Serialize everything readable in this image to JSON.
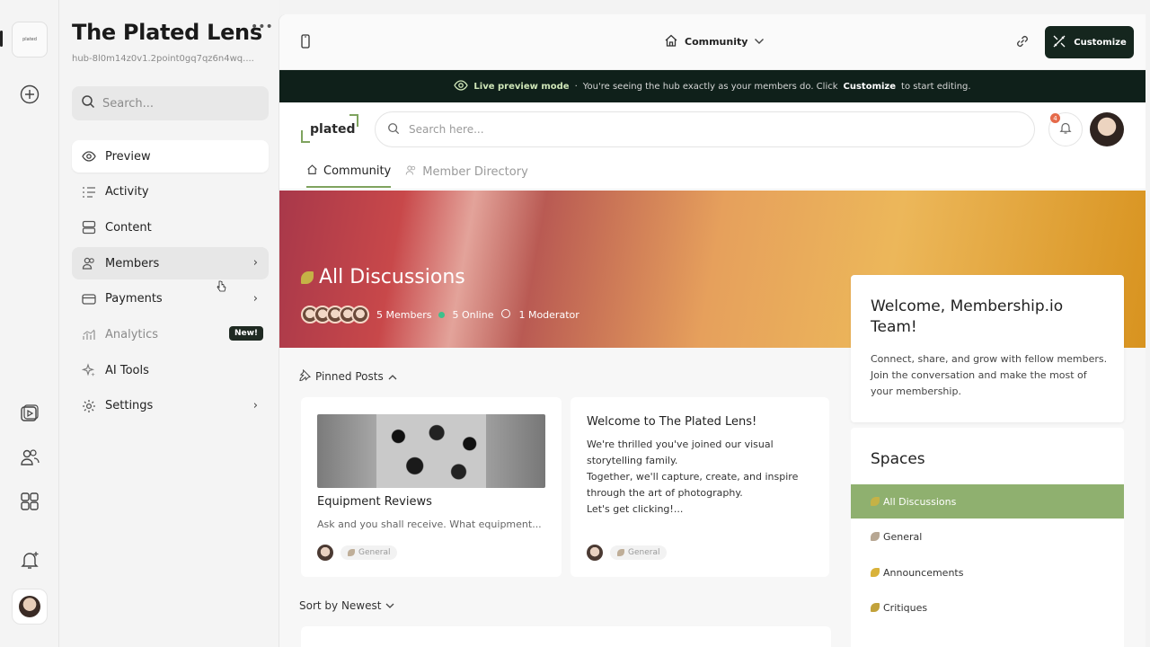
{
  "colors": {
    "accent_green": "#7ea35e",
    "dark_bar": "#0f201a",
    "customize_bg": "#15261e",
    "active_space": "#8fb06f",
    "online_dot": "#3ec08b"
  },
  "rail": {
    "logo_text": "plated",
    "icons": [
      "plus-circle-icon",
      "video-icon",
      "users-icon",
      "grid-icon",
      "bell-plus-icon"
    ]
  },
  "sidebar": {
    "title": "The Plated Lens",
    "more": "•••",
    "subtitle": "hub-8l0m14z0v1.2point0gq7qz6n4wq....",
    "search_placeholder": "Search...",
    "items": [
      {
        "label": "Preview",
        "icon": "eye-icon"
      },
      {
        "label": "Activity",
        "icon": "activity-list-icon"
      },
      {
        "label": "Content",
        "icon": "content-stack-icon"
      },
      {
        "label": "Members",
        "icon": "members-icon"
      },
      {
        "label": "Payments",
        "icon": "card-icon"
      },
      {
        "label": "Analytics",
        "icon": "chart-icon",
        "badge": "New!"
      },
      {
        "label": "AI Tools",
        "icon": "sparkle-icon"
      },
      {
        "label": "Settings",
        "icon": "gear-icon"
      }
    ]
  },
  "topbar": {
    "center_label": "Community",
    "customize_label": "Customize"
  },
  "preview_bar": {
    "mode": "Live preview mode",
    "sep": "·",
    "text": "You're seeing the hub exactly as your members do. Click",
    "bold": "Customize",
    "tail": "to start editing."
  },
  "hub": {
    "logo": "plated",
    "search_placeholder": "Search here...",
    "notif_count": "4",
    "tabs": [
      {
        "label": "Community"
      },
      {
        "label": "Member Directory"
      }
    ]
  },
  "banner": {
    "title": "All Discussions",
    "members": "5 Members",
    "online": "5 Online",
    "moderator": "1 Moderator"
  },
  "pinned": {
    "header": "Pinned Posts",
    "posts": [
      {
        "title": "Equipment Reviews",
        "desc": "Ask and you shall receive. What equipment...",
        "tag": "General"
      },
      {
        "title": "Welcome to The Plated Lens!",
        "desc": "We're thrilled you've joined our visual storytelling family.\nTogether, we'll capture, create, and inspire through the art of photography.\nLet's get clicking!...",
        "tag": "General"
      }
    ]
  },
  "sort": {
    "label": "Sort by Newest"
  },
  "welcome": {
    "title": "Welcome, Membership.io Team!",
    "text": "Connect, share, and grow with fellow members. Join the conversation and make the most of your membership."
  },
  "spaces": {
    "title": "Spaces",
    "items": [
      {
        "label": "All Discussions"
      },
      {
        "label": "General"
      },
      {
        "label": "Announcements"
      },
      {
        "label": "Critiques"
      }
    ]
  }
}
